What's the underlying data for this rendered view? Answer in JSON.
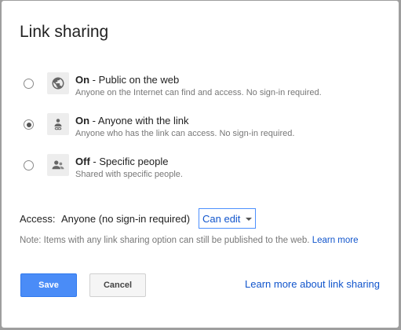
{
  "dialog": {
    "title": "Link sharing",
    "options": [
      {
        "state": "On",
        "label": " - Public on the web",
        "description": "Anyone on the Internet can find and access. No sign-in required.",
        "icon": "globe-icon",
        "selected": false
      },
      {
        "state": "On",
        "label": " - Anyone with the link",
        "description": "Anyone who has the link can access. No sign-in required.",
        "icon": "link-person-icon",
        "selected": true
      },
      {
        "state": "Off",
        "label": " - Specific people",
        "description": "Shared with specific people.",
        "icon": "people-icon",
        "selected": false
      }
    ],
    "access": {
      "label": "Access:",
      "value": "Anyone (no sign-in required)",
      "permission": "Can edit"
    },
    "note": {
      "text": "Note: Items with any link sharing option can still be published to the web.",
      "link": "Learn more"
    },
    "buttons": {
      "save": "Save",
      "cancel": "Cancel"
    },
    "learn_more_link": "Learn more about link sharing"
  },
  "colors": {
    "accent": "#4a8cf7",
    "link": "#1155cc"
  }
}
